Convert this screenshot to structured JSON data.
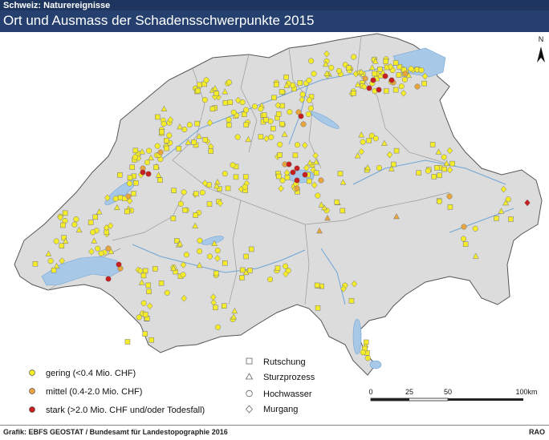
{
  "header": {
    "supertitle": "Schweiz: Naturereignisse",
    "title": "Ort und Ausmass der Schadensschwerpunkte 2015"
  },
  "legend_severity": [
    {
      "label": "gering (<0.4 Mio. CHF)",
      "color": "#f4ec2a"
    },
    {
      "label": "mittel (0.4-2.0 Mio. CHF)",
      "color": "#e8a53c"
    },
    {
      "label": "stark (>2.0 Mio. CHF und/oder Todesfall)",
      "color": "#c81e1e"
    }
  ],
  "legend_process": [
    {
      "label": "Rutschung",
      "shape": "square"
    },
    {
      "label": "Sturzprozess",
      "shape": "triangle"
    },
    {
      "label": "Hochwasser",
      "shape": "circle"
    },
    {
      "label": "Murgang",
      "shape": "diamond"
    }
  ],
  "scalebar": {
    "ticks": [
      "0",
      "25",
      "50",
      "100km"
    ]
  },
  "north_label": "N",
  "colors": {
    "land": "#dcdcdc",
    "lake": "#a8c8e8",
    "river": "#6fa4d6",
    "border": "#555555",
    "header": "#25406f"
  },
  "footer": {
    "credit": "Grafik: EBFS GEOSTAT / Bundesamt für Landestopographie 2016",
    "code": "RAO"
  }
}
